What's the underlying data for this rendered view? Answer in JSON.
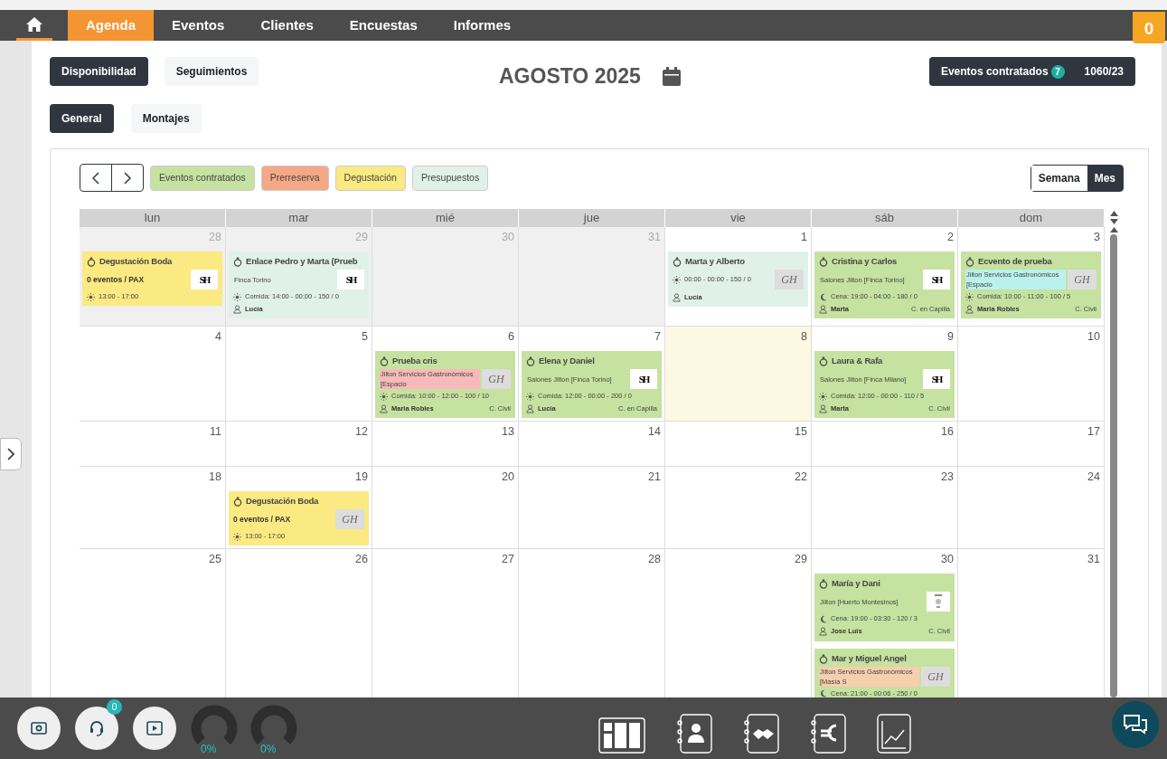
{
  "nav": {
    "tabs": [
      {
        "label": "Agenda",
        "selected": true
      },
      {
        "label": "Eventos",
        "selected": false
      },
      {
        "label": "Clientes",
        "selected": false
      },
      {
        "label": "Encuestas",
        "selected": false
      },
      {
        "label": "Informes",
        "selected": false
      }
    ],
    "notifications": "0"
  },
  "views": [
    {
      "label": "Disponibilidad",
      "selected": true
    },
    {
      "label": "Seguimientos",
      "selected": false
    }
  ],
  "month_title": "AGOSTO 2025",
  "summary": {
    "label": "Eventos contratados",
    "count": "7",
    "value": "1060/23"
  },
  "subviews": [
    {
      "label": "General",
      "selected": true
    },
    {
      "label": "Montajes",
      "selected": false
    }
  ],
  "legend": [
    {
      "label": "Eventos contratados",
      "color": "#c5e2a0"
    },
    {
      "label": "Prerreserva",
      "color": "#f5a886"
    },
    {
      "label": "Degustación",
      "color": "#fbe982"
    },
    {
      "label": "Presupuestos",
      "color": "#e0f1ea"
    }
  ],
  "modes": [
    {
      "label": "Semana",
      "selected": false
    },
    {
      "label": "Mes",
      "selected": true
    }
  ],
  "weekdays": [
    "lun",
    "mar",
    "mié",
    "jue",
    "vie",
    "sáb",
    "dom"
  ],
  "weeks": [
    [
      {
        "day": "28",
        "other_month": true,
        "events": [
          {
            "kind": "tasting",
            "title": "Degustación Boda",
            "subtitle": "0 eventos / PAX",
            "night": false,
            "schedule": "13:00 - 17:00",
            "logo": {
              "kind": "sh",
              "text": "SH"
            }
          }
        ]
      },
      {
        "day": "29",
        "other_month": true,
        "events": [
          {
            "kind": "quote",
            "title": "Enlace Pedro y Marta (Prueb",
            "venue": {
              "label": "Finca Torino"
            },
            "night": false,
            "schedule": "Comida: 14:00 - 00:00 - 150 / 0",
            "person": "Lucía",
            "logo": {
              "kind": "sh",
              "text": "SH"
            }
          }
        ]
      },
      {
        "day": "30",
        "other_month": true
      },
      {
        "day": "31",
        "other_month": true
      },
      {
        "day": "1",
        "events": [
          {
            "kind": "quote",
            "title": "Marta y Alberto",
            "night": false,
            "schedule": "00:00 - 00:00 - 150 / 0",
            "person": "Lucía",
            "logo": {
              "kind": "gh",
              "text": "GH"
            }
          }
        ]
      },
      {
        "day": "2",
        "events": [
          {
            "kind": "contracted",
            "title": "Cristina y Carlos",
            "venue": {
              "label": "Salones Jilton [Finca Torino]"
            },
            "night": true,
            "schedule": "Cena: 19:00 - 04:00 - 180 / 0",
            "person": "Marta",
            "ceremony": "C. en Capilla",
            "logo": {
              "kind": "sh",
              "text": "SH"
            }
          }
        ]
      },
      {
        "day": "3",
        "events": [
          {
            "kind": "contracted",
            "title": "Ecvento de prueba",
            "venue": {
              "label": "Jilton Servicios Gastronómicos [Espacio",
              "color": "#b9f2ec"
            },
            "night": false,
            "schedule": "Comida: 10:00 - 11:00 - 100 / 5",
            "person": "Maria Robles",
            "ceremony": "C. Civil",
            "logo": {
              "kind": "gh",
              "text": "GH"
            }
          }
        ]
      }
    ],
    [
      {
        "day": "4"
      },
      {
        "day": "5"
      },
      {
        "day": "6",
        "events": [
          {
            "kind": "contracted",
            "title": "Prueba cris",
            "venue": {
              "label": "Jilton Servicios Gastronómicos [Espacio",
              "color": "#f7b9b9"
            },
            "night": false,
            "schedule": "Comida: 10:00 - 12:00 - 100 / 10",
            "person": "Maria Robles",
            "ceremony": "C. Civil",
            "logo": {
              "kind": "gh",
              "text": "GH"
            }
          }
        ]
      },
      {
        "day": "7",
        "events": [
          {
            "kind": "contracted",
            "title": "Elena y Daniel",
            "venue": {
              "label": "Salones Jilton [Finca Torino]"
            },
            "night": false,
            "schedule": "Comida: 12:00 - 00:00 - 200 / 0",
            "person": "Lucía",
            "ceremony": "C. en Capilla",
            "logo": {
              "kind": "sh",
              "text": "SH"
            }
          }
        ]
      },
      {
        "day": "8",
        "today": true
      },
      {
        "day": "9",
        "events": [
          {
            "kind": "contracted",
            "title": "Laura & Rafa",
            "venue": {
              "label": "Salones Jilton [Finca Milano]"
            },
            "night": false,
            "schedule": "Comida: 12:00 - 00:00 - 110 / 5",
            "person": "Marta",
            "ceremony": "C. Civil",
            "logo": {
              "kind": "sh",
              "text": "SH"
            }
          }
        ]
      },
      {
        "day": "10"
      }
    ],
    [
      {
        "day": "11"
      },
      {
        "day": "12"
      },
      {
        "day": "13"
      },
      {
        "day": "14"
      },
      {
        "day": "15"
      },
      {
        "day": "16"
      },
      {
        "day": "17"
      }
    ],
    [
      {
        "day": "18"
      },
      {
        "day": "19",
        "events": [
          {
            "kind": "tasting",
            "title": "Degustación Boda",
            "subtitle": "0 eventos / PAX",
            "night": false,
            "schedule": "13:00 - 17:00",
            "logo": {
              "kind": "gh",
              "text": "GH"
            }
          }
        ]
      },
      {
        "day": "20"
      },
      {
        "day": "21"
      },
      {
        "day": "22"
      },
      {
        "day": "23"
      },
      {
        "day": "24"
      }
    ],
    [
      {
        "day": "25"
      },
      {
        "day": "26"
      },
      {
        "day": "27"
      },
      {
        "day": "28"
      },
      {
        "day": "29"
      },
      {
        "day": "30",
        "events": [
          {
            "kind": "contracted",
            "title": "María y Dani",
            "venue": {
              "label": "Jilton [Huerto Montesinos]"
            },
            "night": true,
            "schedule": "Cena: 19:00 - 03:30 - 120 / 3",
            "person": "Jose Luis",
            "ceremony": "C. Civil",
            "logo": {
              "kind": "image"
            }
          },
          {
            "kind": "contracted",
            "title": "Mar y Miguel Angel",
            "venue": {
              "label": "Jilton Servicios Gastronómicos [Masía S",
              "color": "#f6cfae"
            },
            "night": true,
            "schedule": "Cena: 21:00 - 00:06 - 250 / 0",
            "logo": {
              "kind": "gh",
              "text": "GH"
            }
          }
        ]
      },
      {
        "day": "31"
      }
    ]
  ],
  "bottom": {
    "support_badge": "0",
    "gauges": [
      {
        "reading": "0%"
      },
      {
        "reading": "0%"
      }
    ]
  }
}
